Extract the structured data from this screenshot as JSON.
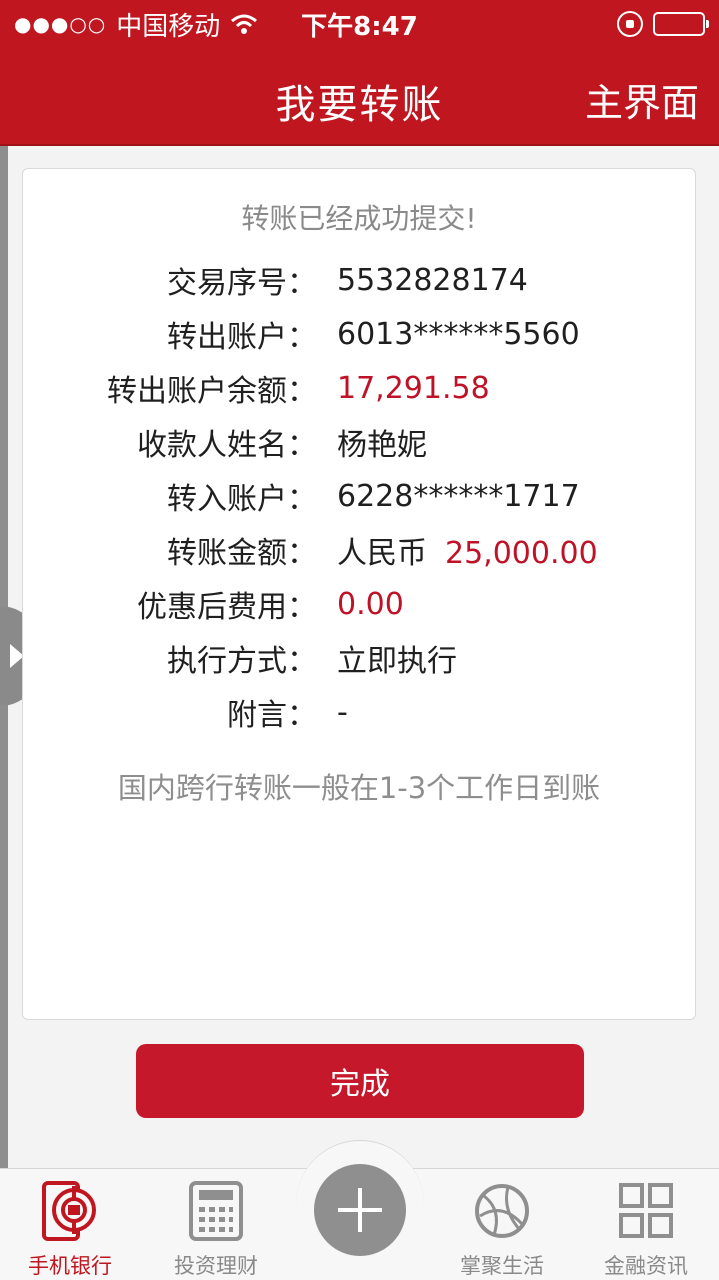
{
  "status_bar": {
    "signal": "●●●○○",
    "carrier": "中国移动",
    "time": "下午8:47"
  },
  "nav": {
    "title": "我要转账",
    "home_label": "主界面"
  },
  "receipt": {
    "title": "转账已经成功提交!",
    "rows": [
      {
        "label": "交易序号：",
        "value": "5532828174"
      },
      {
        "label": "转出账户：",
        "value": "6013******5560"
      },
      {
        "label": "转出账户余额：",
        "value": "17,291.58"
      },
      {
        "label": "收款人姓名：",
        "value": "杨艳妮"
      },
      {
        "label": "转入账户：",
        "value": "6228******1717"
      },
      {
        "label": "转账金额：",
        "currency": "人民币",
        "value": "25,000.00"
      },
      {
        "label": "优惠后费用：",
        "value": "0.00"
      },
      {
        "label": "执行方式：",
        "value": "立即执行"
      },
      {
        "label": "附言：",
        "value": "-"
      }
    ],
    "note": "国内跨行转账一般在1-3个工作日到账"
  },
  "done_button": "完成",
  "tabs": [
    {
      "label": "手机银行",
      "icon": "bank-phone-icon",
      "active": true
    },
    {
      "label": "投资理财",
      "icon": "calculator-icon",
      "active": false
    },
    {
      "label": "掌聚生活",
      "icon": "globe-icon",
      "active": false
    },
    {
      "label": "金融资讯",
      "icon": "grid-icon",
      "active": false
    }
  ],
  "colors": {
    "brand_red": "#c0161f",
    "amount_red": "#c01226",
    "button_red": "#c5192b"
  }
}
